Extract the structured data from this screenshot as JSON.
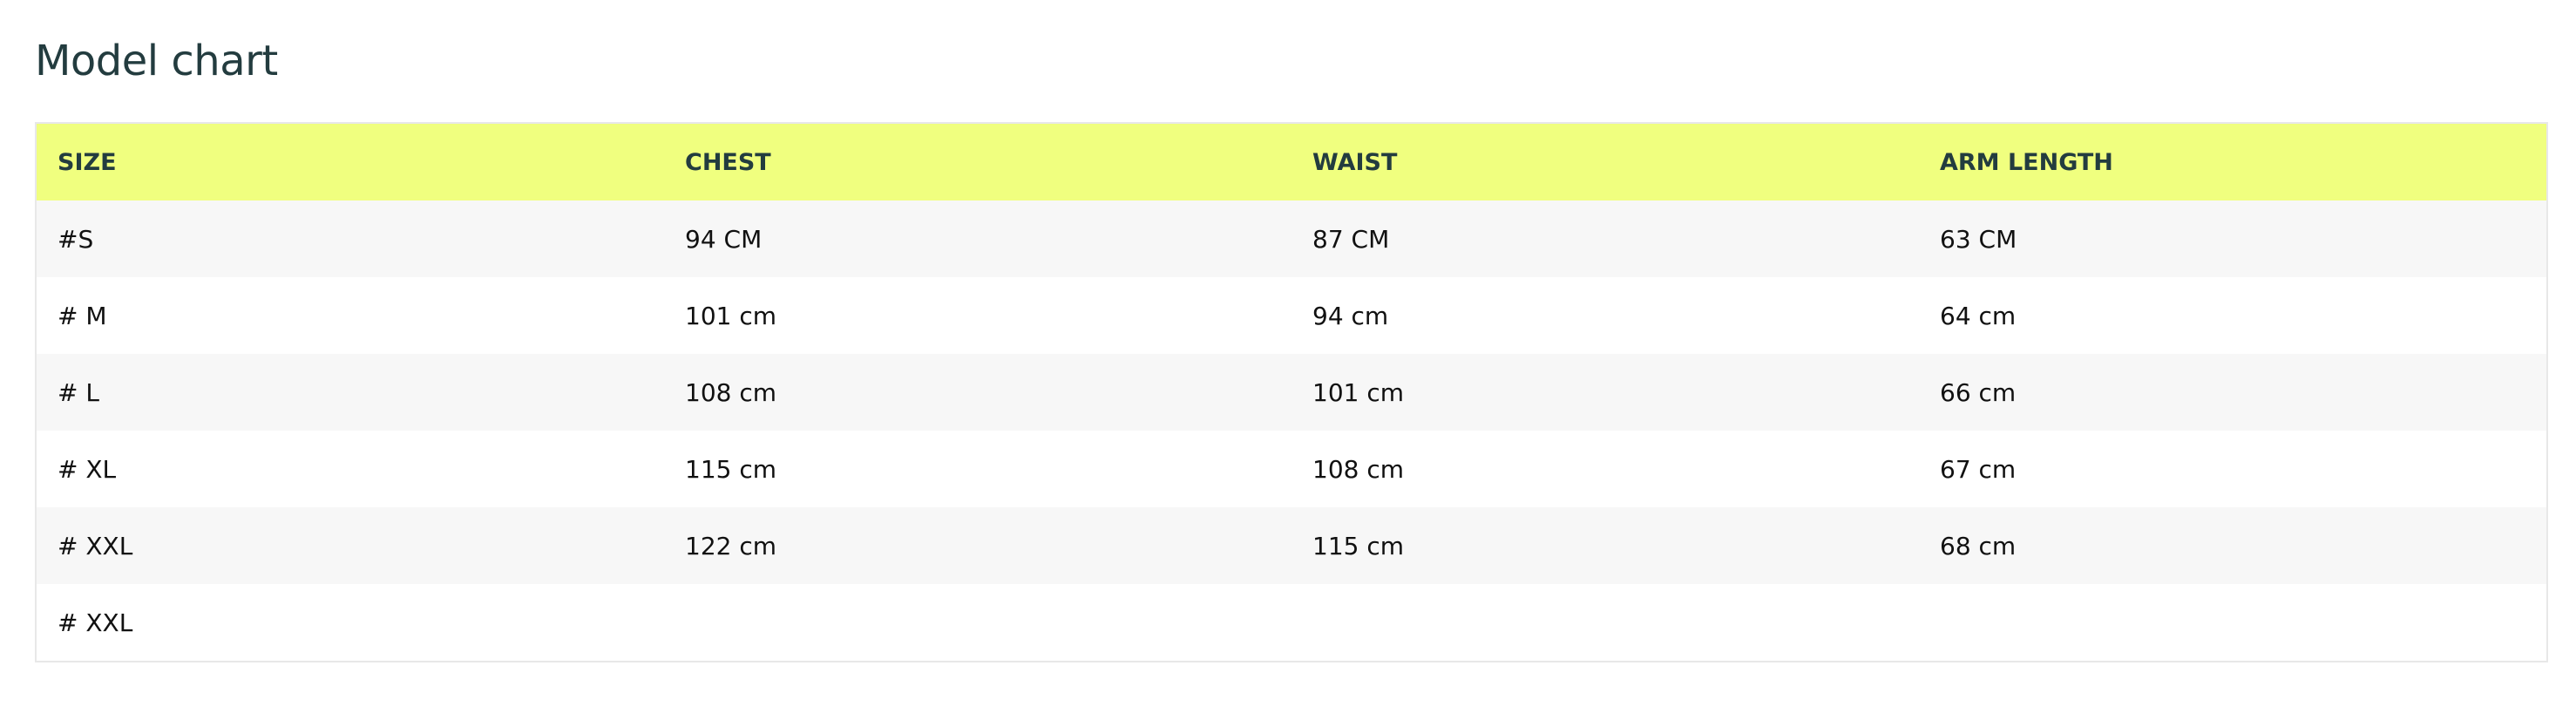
{
  "title": "Model chart",
  "table": {
    "headers": [
      "SIZE",
      "CHEST",
      "WAIST",
      "ARM LENGTH"
    ],
    "rows": [
      [
        "#S",
        "94 CM",
        "87 CM",
        "63 CM"
      ],
      [
        "# M",
        "101 cm",
        "94 cm",
        "64 cm"
      ],
      [
        "# L",
        "108 cm",
        "101 cm",
        "66 cm"
      ],
      [
        "# XL",
        "115 cm",
        "108 cm",
        "67 cm"
      ],
      [
        "# XXL",
        "122 cm",
        "115 cm",
        "68 cm"
      ],
      [
        "# XXL",
        "",
        "",
        ""
      ]
    ]
  },
  "colors": {
    "header_background": "#f0ff7f",
    "striped_row": "#f7f7f7",
    "title_text": "#233c3f"
  }
}
